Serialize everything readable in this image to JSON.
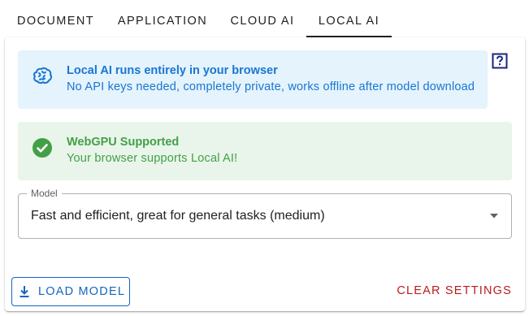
{
  "tabs": [
    {
      "label": "DOCUMENT"
    },
    {
      "label": "APPLICATION"
    },
    {
      "label": "CLOUD AI"
    },
    {
      "label": "LOCAL AI",
      "active": true
    }
  ],
  "info_alert": {
    "icon": "brain-icon",
    "title": "Local AI runs entirely in your browser",
    "description": "No API keys needed, completely private, works offline after model download"
  },
  "help": {
    "icon": "help-icon"
  },
  "success_alert": {
    "icon": "check-circle-icon",
    "title": "WebGPU Supported",
    "description": "Your browser supports Local AI!"
  },
  "model_select": {
    "label": "Model",
    "value": "Fast and efficient, great for general tasks (medium)"
  },
  "actions": {
    "load_model": "LOAD MODEL",
    "clear_settings": "CLEAR SETTINGS"
  },
  "colors": {
    "info_text": "#1976d2",
    "info_bg": "#e5f3fc",
    "success_text": "#43a047",
    "success_bg": "#e9f5ea",
    "primary": "#1565c0",
    "danger": "#b71c1c"
  }
}
